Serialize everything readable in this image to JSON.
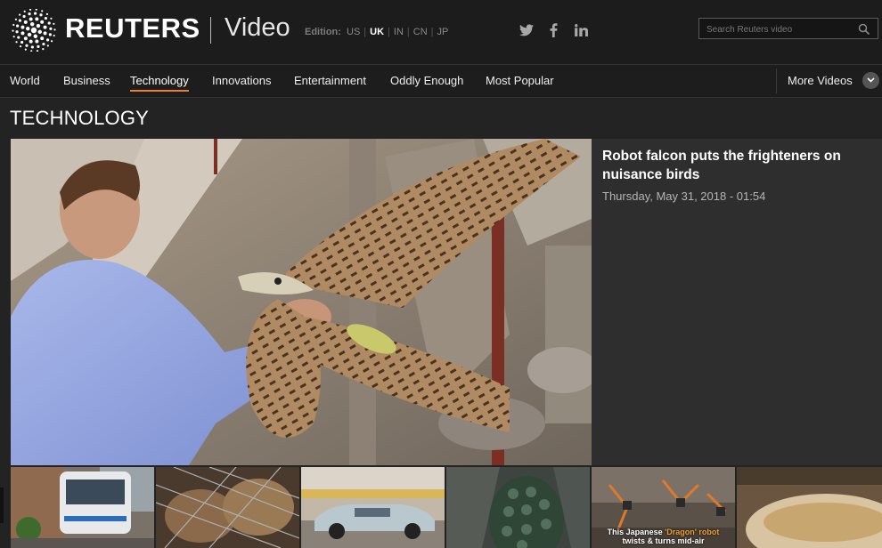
{
  "header": {
    "brand": "REUTERS",
    "section": "Video",
    "edition_label": "Edition:",
    "editions": [
      {
        "label": "US",
        "active": false
      },
      {
        "label": "UK",
        "active": true
      },
      {
        "label": "IN",
        "active": false
      },
      {
        "label": "CN",
        "active": false
      },
      {
        "label": "JP",
        "active": false
      }
    ],
    "social_icons": [
      "twitter-icon",
      "facebook-icon",
      "linkedin-icon"
    ],
    "search": {
      "placeholder": "Search Reuters video",
      "value": ""
    }
  },
  "nav": {
    "items": [
      {
        "label": "World",
        "active": false
      },
      {
        "label": "Business",
        "active": false
      },
      {
        "label": "Technology",
        "active": true
      },
      {
        "label": "Innovations",
        "active": false
      },
      {
        "label": "Entertainment",
        "active": false
      },
      {
        "label": "Oddly Enough",
        "active": false
      },
      {
        "label": "Most Popular",
        "active": false
      }
    ],
    "more_label": "More Videos"
  },
  "page": {
    "title": "TECHNOLOGY"
  },
  "feature": {
    "title": "Robot falcon puts the frighteners on nuisance birds",
    "date": "Thursday, May 31, 2018 - 01:54"
  },
  "thumbnails": [
    {
      "caption_pre": "",
      "caption_hl": "",
      "caption_post": "",
      "caption_line2": ""
    },
    {
      "caption_pre": "",
      "caption_hl": "",
      "caption_post": "",
      "caption_line2": ""
    },
    {
      "caption_pre": "",
      "caption_hl": "",
      "caption_post": "",
      "caption_line2": ""
    },
    {
      "caption_pre": "",
      "caption_hl": "",
      "caption_post": "",
      "caption_line2": ""
    },
    {
      "caption_pre": "This Japanese ",
      "caption_hl": "'Dragon' robot",
      "caption_post": "",
      "caption_line2": "twists & turns mid-air"
    },
    {
      "caption_pre": "",
      "caption_hl": "",
      "caption_post": "",
      "caption_line2": ""
    }
  ],
  "colors": {
    "accent": "#f07d1e",
    "background": "#232323",
    "header": "#1c1c1c"
  }
}
